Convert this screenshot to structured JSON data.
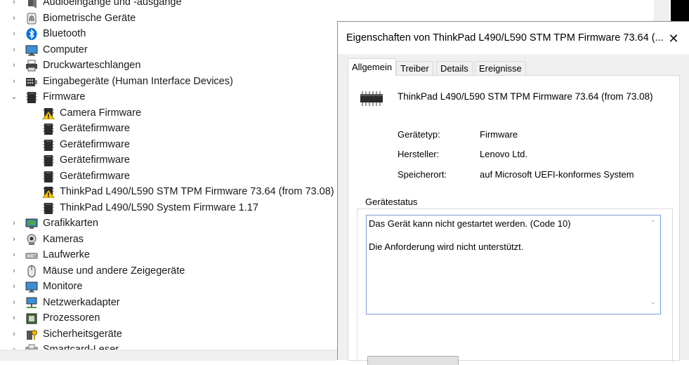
{
  "tree": {
    "items": [
      {
        "label": "Audioeingänge und -ausgänge",
        "level": 0,
        "expander": "›",
        "icon": "speaker-icon"
      },
      {
        "label": "Biometrische Geräte",
        "level": 0,
        "expander": "›",
        "icon": "fingerprint-icon"
      },
      {
        "label": "Bluetooth",
        "level": 0,
        "expander": "›",
        "icon": "bluetooth-icon"
      },
      {
        "label": "Computer",
        "level": 0,
        "expander": "›",
        "icon": "computer-monitor-icon"
      },
      {
        "label": "Druckwarteschlangen",
        "level": 0,
        "expander": "›",
        "icon": "printer-icon"
      },
      {
        "label": "Eingabegeräte (Human Interface Devices)",
        "level": 0,
        "expander": "›",
        "icon": "hid-keyboard-icon"
      },
      {
        "label": "Firmware",
        "level": 0,
        "expander": "⌄",
        "icon": "firmware-chip-icon"
      },
      {
        "label": "Camera Firmware",
        "level": 1,
        "expander": "",
        "icon": "firmware-warning-icon"
      },
      {
        "label": "Gerätefirmware",
        "level": 1,
        "expander": "",
        "icon": "firmware-chip-icon"
      },
      {
        "label": "Gerätefirmware",
        "level": 1,
        "expander": "",
        "icon": "firmware-chip-icon"
      },
      {
        "label": "Gerätefirmware",
        "level": 1,
        "expander": "",
        "icon": "firmware-chip-icon"
      },
      {
        "label": "Gerätefirmware",
        "level": 1,
        "expander": "",
        "icon": "firmware-chip-icon"
      },
      {
        "label": "ThinkPad L490/L590 STM TPM Firmware 73.64 (from 73.08)",
        "level": 1,
        "expander": "",
        "icon": "firmware-warning-icon"
      },
      {
        "label": "ThinkPad L490/L590 System Firmware 1.17",
        "level": 1,
        "expander": "",
        "icon": "firmware-chip-icon"
      },
      {
        "label": "Grafikkarten",
        "level": 0,
        "expander": "›",
        "icon": "display-adapter-icon"
      },
      {
        "label": "Kameras",
        "level": 0,
        "expander": "›",
        "icon": "webcam-icon"
      },
      {
        "label": "Laufwerke",
        "level": 0,
        "expander": "›",
        "icon": "disk-drive-icon"
      },
      {
        "label": "Mäuse und andere Zeigegeräte",
        "level": 0,
        "expander": "›",
        "icon": "mouse-icon"
      },
      {
        "label": "Monitore",
        "level": 0,
        "expander": "›",
        "icon": "monitor-icon"
      },
      {
        "label": "Netzwerkadapter",
        "level": 0,
        "expander": "›",
        "icon": "network-adapter-icon"
      },
      {
        "label": "Prozessoren",
        "level": 0,
        "expander": "›",
        "icon": "processor-icon"
      },
      {
        "label": "Sicherheitsgeräte",
        "level": 0,
        "expander": "›",
        "icon": "security-key-icon"
      },
      {
        "label": "Smartcard-Leser",
        "level": 0,
        "expander": "›",
        "icon": "smartcard-reader-icon"
      }
    ]
  },
  "dialog": {
    "title": "Eigenschaften von ThinkPad L490/L590 STM TPM Firmware 73.64 (...",
    "close_glyph": "✕",
    "tabs": [
      {
        "label": "Allgemein",
        "active": true
      },
      {
        "label": "Treiber",
        "active": false
      },
      {
        "label": "Details",
        "active": false
      },
      {
        "label": "Ereignisse",
        "active": false
      }
    ],
    "device_name": "ThinkPad L490/L590 STM TPM Firmware 73.64 (from 73.08)",
    "device_icon": "firmware-chip-icon",
    "properties": [
      {
        "key": "Gerätetyp:",
        "value": "Firmware"
      },
      {
        "key": "Hersteller:",
        "value": "Lenovo Ltd."
      },
      {
        "key": "Speicherort:",
        "value": "auf Microsoft UEFI-konformes System"
      }
    ],
    "status": {
      "group_label": "Gerätestatus",
      "lines": [
        "Das Gerät kann nicht gestartet werden. (Code 10)",
        "Die Anforderung wird nicht unterstützt."
      ],
      "scroll_up": "⌃",
      "scroll_down": "⌄"
    }
  },
  "colors": {
    "warning_yellow": "#f5c400",
    "bluetooth_blue": "#0a6fd8",
    "chip_dark": "#2b2b2b",
    "dialog_bg": "#f0f0f0",
    "status_border": "#7a9cd3"
  }
}
